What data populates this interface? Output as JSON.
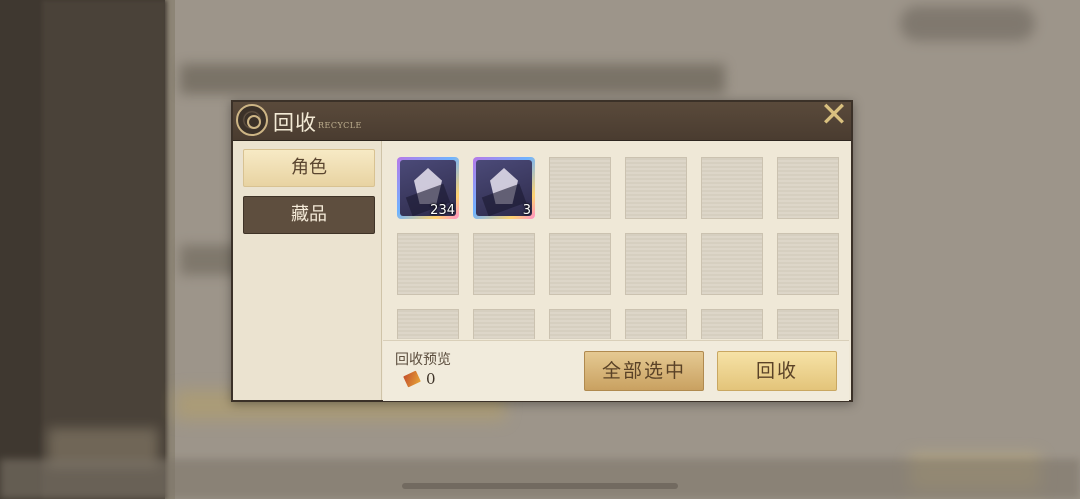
{
  "dialog": {
    "title": "回收",
    "subtitle": "RECYCLE"
  },
  "tabs": [
    {
      "label": "角色",
      "active": true
    },
    {
      "label": "藏品",
      "active": false
    }
  ],
  "items": [
    {
      "count": "234",
      "rarity": "rainbow"
    },
    {
      "count": "3",
      "rarity": "rainbow"
    }
  ],
  "footer": {
    "preview_label": "回收预览",
    "preview_value": "0",
    "select_all_label": "全部选中",
    "recycle_label": "回收"
  },
  "icons": {
    "close": "close-icon",
    "emblem": "emblem-icon",
    "currency": "currency-icon"
  },
  "colors": {
    "accent_gold": "#d9c07f",
    "title_bar": "#4a3c30",
    "panel": "#efe8d7"
  }
}
